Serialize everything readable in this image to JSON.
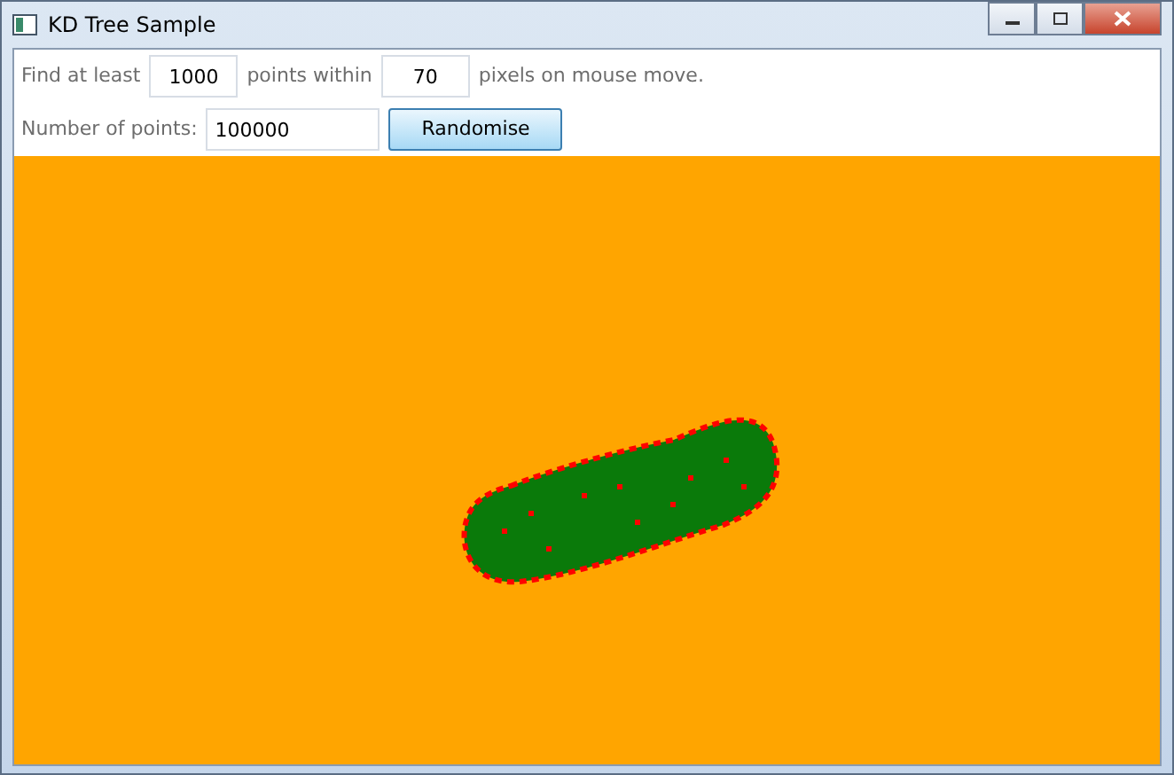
{
  "window": {
    "title": "KD Tree Sample"
  },
  "search_row": {
    "label_1": "Find at least",
    "count": "1000",
    "label_2": "points within",
    "radius": "70",
    "label_3": "pixels on mouse move."
  },
  "points_row": {
    "label": "Number of points:",
    "value": "100000",
    "button": "Randomise"
  }
}
